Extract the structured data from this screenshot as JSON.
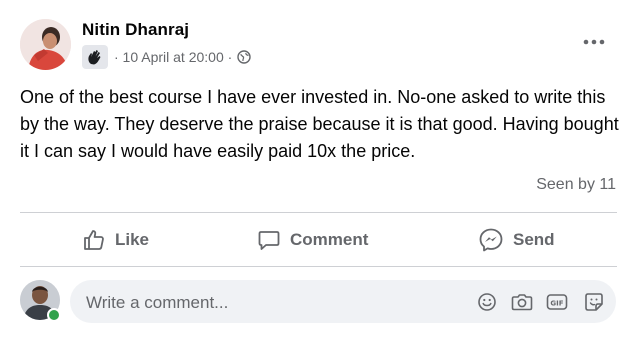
{
  "post": {
    "author": "Nitin Dhanraj",
    "meta": "· 10 April at 20:00 ·",
    "text": "One of the best course I have ever invested in. No-one asked to write this by the way. They deserve the praise because it is that good. Having bought it I can say I would have easily paid 10x the price.",
    "seen": "Seen by 11"
  },
  "actions": {
    "like": "Like",
    "comment": "Comment",
    "send": "Send"
  },
  "composer": {
    "placeholder": "Write a comment..."
  },
  "colors": {
    "secondary_text": "#65676b",
    "divider": "#ced0d4",
    "composer_bg": "#f0f2f5",
    "online": "#31a24c"
  },
  "icons": [
    "hand-wave-icon",
    "globe-icon",
    "more-icon",
    "like-icon",
    "comment-icon",
    "messenger-icon",
    "emoji-icon",
    "camera-icon",
    "gif-icon",
    "sticker-icon"
  ]
}
